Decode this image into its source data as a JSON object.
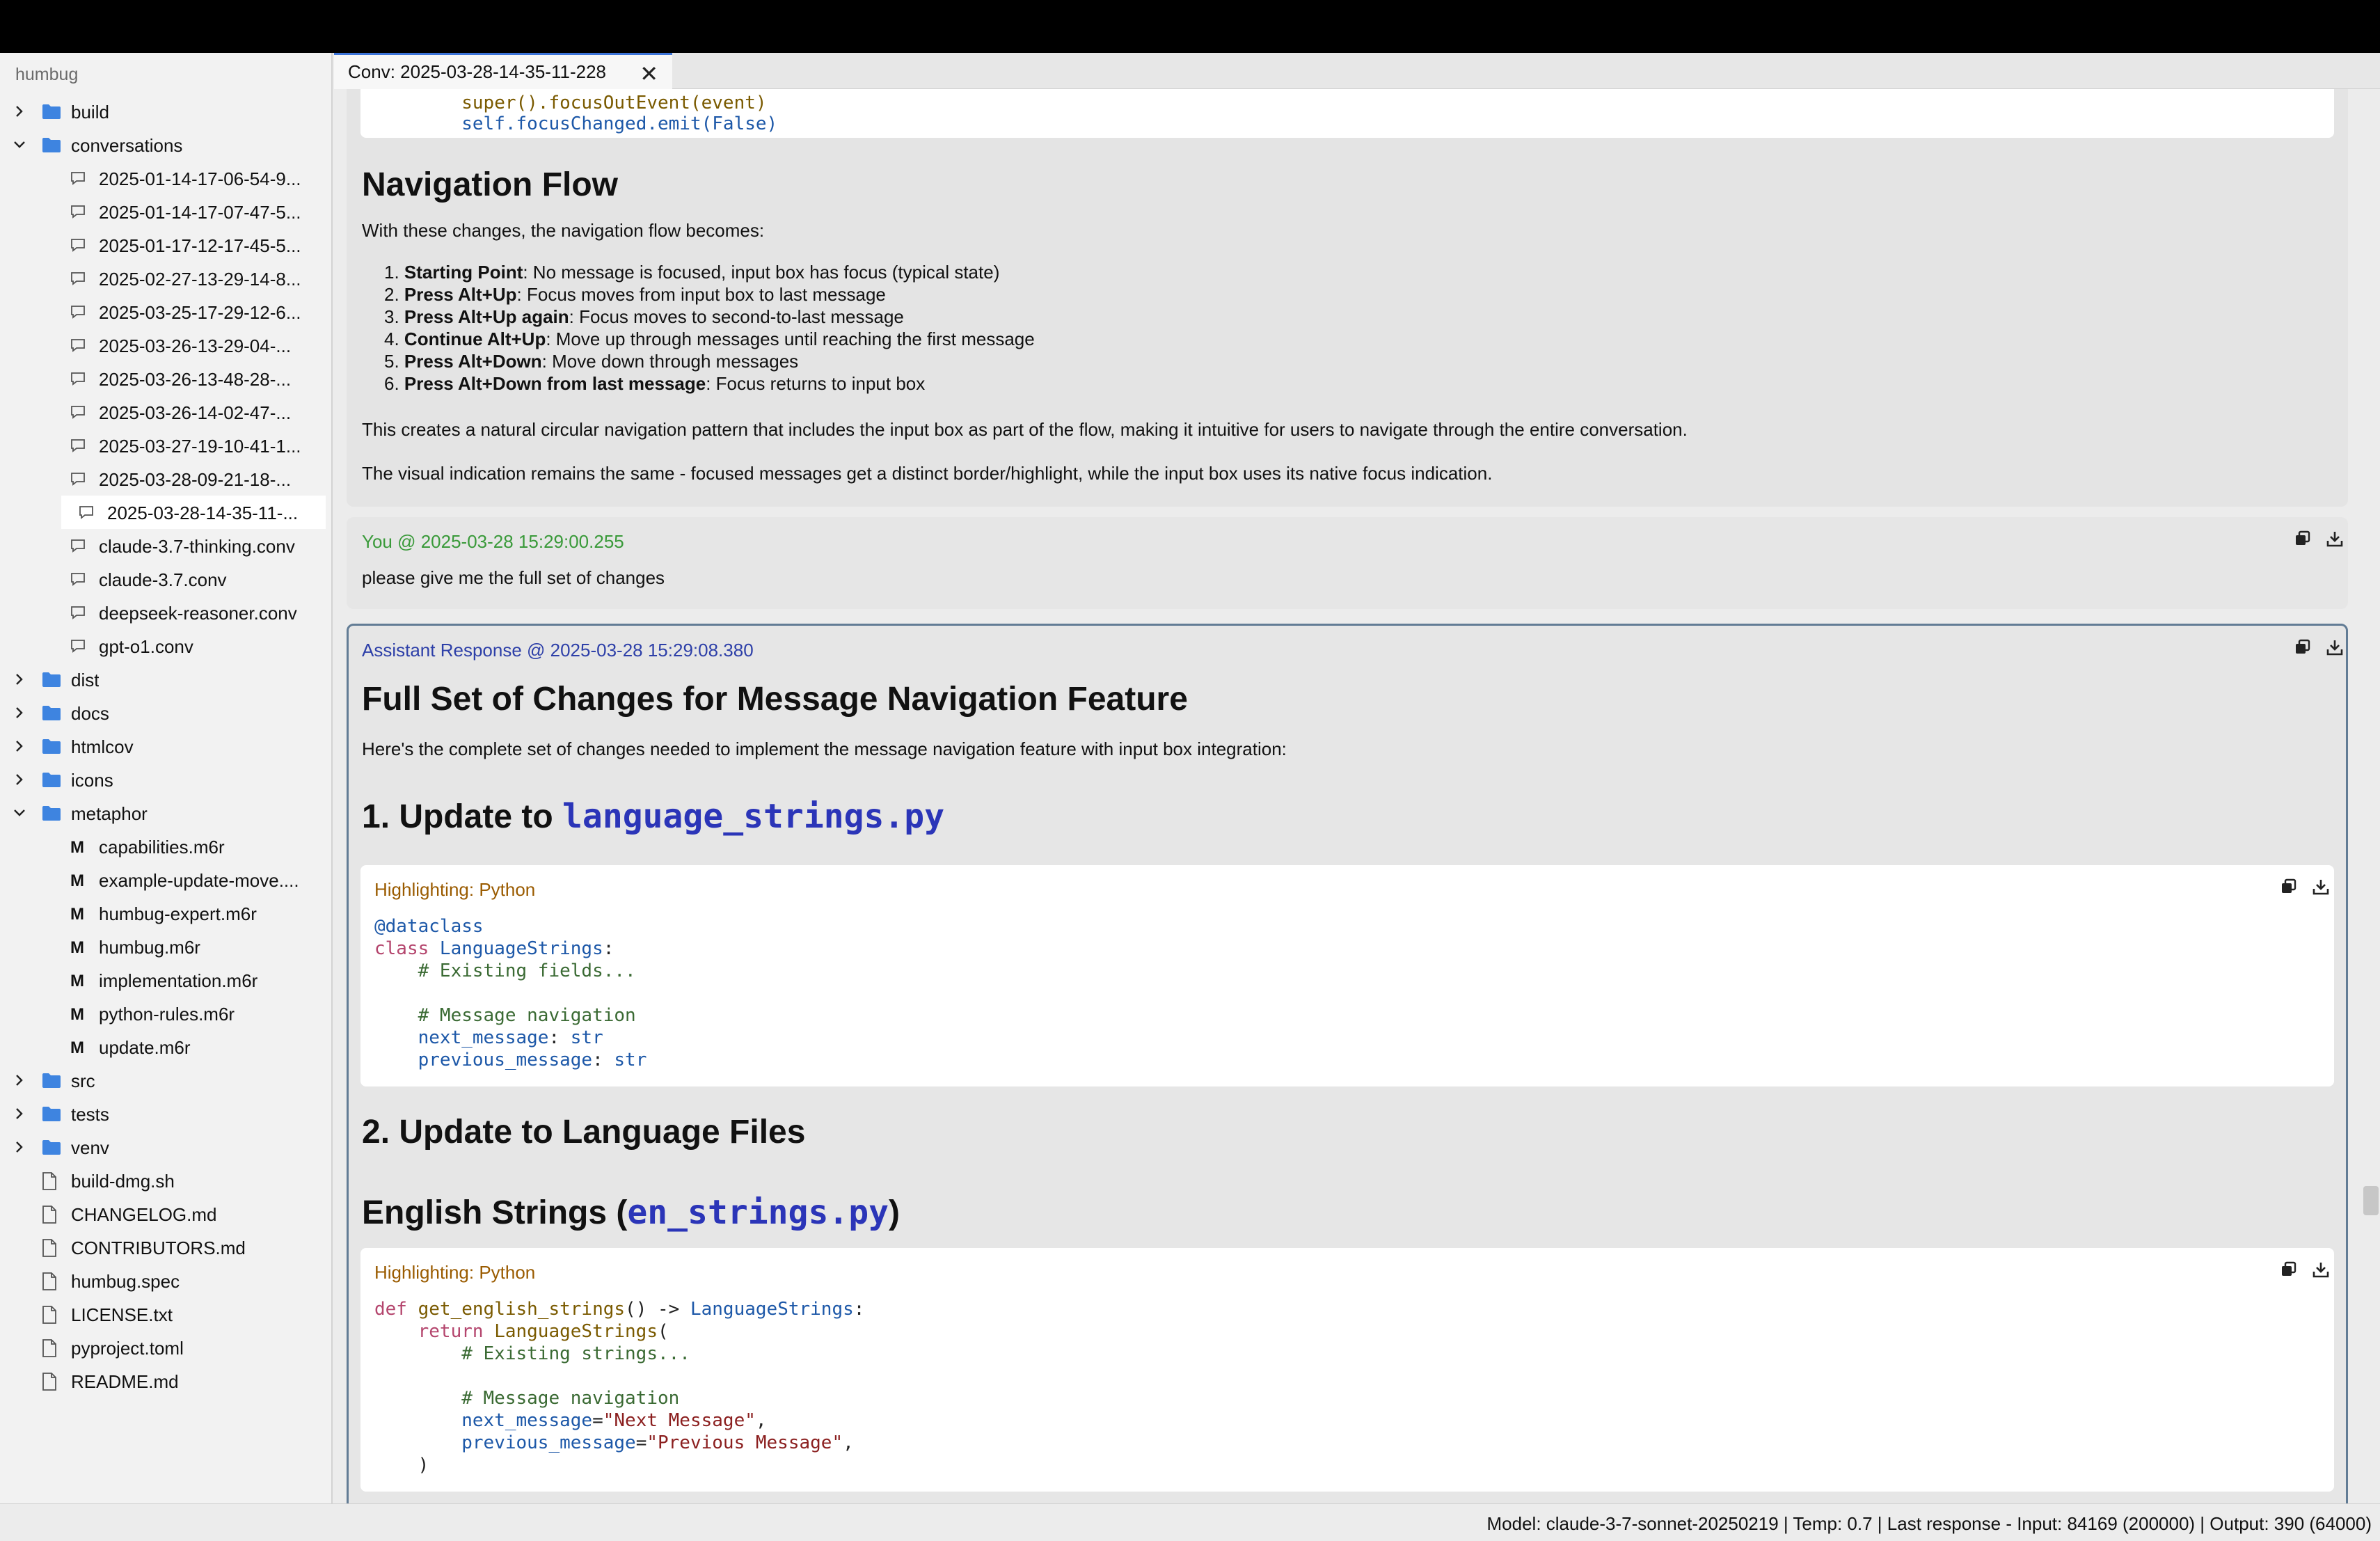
{
  "sidebar": {
    "root": "humbug",
    "items": [
      {
        "label": "build",
        "type": "folder",
        "expanded": false,
        "depth": 0
      },
      {
        "label": "conversations",
        "type": "folder",
        "expanded": true,
        "depth": 0
      },
      {
        "label": "2025-01-14-17-06-54-9...",
        "type": "conv",
        "depth": 1
      },
      {
        "label": "2025-01-14-17-07-47-5...",
        "type": "conv",
        "depth": 1
      },
      {
        "label": "2025-01-17-12-17-45-5...",
        "type": "conv",
        "depth": 1
      },
      {
        "label": "2025-02-27-13-29-14-8...",
        "type": "conv",
        "depth": 1
      },
      {
        "label": "2025-03-25-17-29-12-6...",
        "type": "conv",
        "depth": 1
      },
      {
        "label": "2025-03-26-13-29-04-...",
        "type": "conv",
        "depth": 1
      },
      {
        "label": "2025-03-26-13-48-28-...",
        "type": "conv",
        "depth": 1
      },
      {
        "label": "2025-03-26-14-02-47-...",
        "type": "conv",
        "depth": 1
      },
      {
        "label": "2025-03-27-19-10-41-1...",
        "type": "conv",
        "depth": 1
      },
      {
        "label": "2025-03-28-09-21-18-...",
        "type": "conv",
        "depth": 1
      },
      {
        "label": "2025-03-28-14-35-11-...",
        "type": "conv",
        "depth": 1,
        "selected": true
      },
      {
        "label": "claude-3.7-thinking.conv",
        "type": "conv",
        "depth": 1
      },
      {
        "label": "claude-3.7.conv",
        "type": "conv",
        "depth": 1
      },
      {
        "label": "deepseek-reasoner.conv",
        "type": "conv",
        "depth": 1
      },
      {
        "label": "gpt-o1.conv",
        "type": "conv",
        "depth": 1
      },
      {
        "label": "dist",
        "type": "folder",
        "expanded": false,
        "depth": 0
      },
      {
        "label": "docs",
        "type": "folder",
        "expanded": false,
        "depth": 0
      },
      {
        "label": "htmlcov",
        "type": "folder",
        "expanded": false,
        "depth": 0
      },
      {
        "label": "icons",
        "type": "folder",
        "expanded": false,
        "depth": 0
      },
      {
        "label": "metaphor",
        "type": "folder",
        "expanded": true,
        "depth": 0
      },
      {
        "label": "capabilities.m6r",
        "type": "m6r",
        "depth": 1
      },
      {
        "label": "example-update-move....",
        "type": "m6r",
        "depth": 1
      },
      {
        "label": "humbug-expert.m6r",
        "type": "m6r",
        "depth": 1
      },
      {
        "label": "humbug.m6r",
        "type": "m6r",
        "depth": 1
      },
      {
        "label": "implementation.m6r",
        "type": "m6r",
        "depth": 1
      },
      {
        "label": "python-rules.m6r",
        "type": "m6r",
        "depth": 1
      },
      {
        "label": "update.m6r",
        "type": "m6r",
        "depth": 1
      },
      {
        "label": "src",
        "type": "folder",
        "expanded": false,
        "depth": 0
      },
      {
        "label": "tests",
        "type": "folder",
        "expanded": false,
        "depth": 0
      },
      {
        "label": "venv",
        "type": "folder",
        "expanded": false,
        "depth": 0
      },
      {
        "label": "build-dmg.sh",
        "type": "file",
        "depth": 0
      },
      {
        "label": "CHANGELOG.md",
        "type": "file",
        "depth": 0
      },
      {
        "label": "CONTRIBUTORS.md",
        "type": "file",
        "depth": 0
      },
      {
        "label": "humbug.spec",
        "type": "file",
        "depth": 0
      },
      {
        "label": "LICENSE.txt",
        "type": "file",
        "depth": 0
      },
      {
        "label": "pyproject.toml",
        "type": "file",
        "depth": 0
      },
      {
        "label": "README.md",
        "type": "file",
        "depth": 0
      }
    ]
  },
  "tab": {
    "label": "Conv: 2025-03-28-14-35-11-228",
    "close": "✕"
  },
  "msg1": {
    "code_tail_1": "super().focusOutEvent(event)",
    "code_tail_2": "self.focusChanged.emit(False)",
    "heading": "Navigation Flow",
    "intro": "With these changes, the navigation flow becomes:",
    "steps": [
      {
        "n": "1.",
        "bold": "Starting Point",
        "text": ": No message is focused, input box has focus (typical state)"
      },
      {
        "n": "2.",
        "bold": "Press Alt+Up",
        "text": ": Focus moves from input box to last message"
      },
      {
        "n": "3.",
        "bold": "Press Alt+Up again",
        "text": ": Focus moves to second-to-last message"
      },
      {
        "n": "4.",
        "bold": "Continue Alt+Up",
        "text": ": Move up through messages until reaching the first message"
      },
      {
        "n": "5.",
        "bold": "Press Alt+Down",
        "text": ": Move down through messages"
      },
      {
        "n": "6.",
        "bold": "Press Alt+Down from last message",
        "text": ": Focus returns to input box"
      }
    ],
    "para1": "This creates a natural circular navigation pattern that includes the input box as part of the flow, making it intuitive for users to navigate through the entire conversation.",
    "para2": "The visual indication remains the same - focused messages get a distinct border/highlight, while the input box uses its native focus indication."
  },
  "msg2": {
    "header": "You @ 2025-03-28 15:29:00.255",
    "text": "please give me the full set of changes"
  },
  "msg3": {
    "header": "Assistant Response @ 2025-03-28 15:29:08.380",
    "title": "Full Set of Changes for Message Navigation Feature",
    "intro": "Here's the complete set of changes needed to implement the message navigation feature with input box integration:",
    "h_update1_prefix": "1. Update to ",
    "h_update1_code": "language_strings.py",
    "code1_label": "Highlighting: Python",
    "h_update2": "2. Update to Language Files",
    "h_english_prefix": "English Strings (",
    "h_english_code": "en_strings.py",
    "h_english_suffix": ")",
    "code2_label": "Highlighting: Python"
  },
  "code1_lines": [
    [
      [
        "dc",
        "@"
      ],
      [
        "id",
        "dataclass"
      ]
    ],
    [
      [
        "kw",
        "class "
      ],
      [
        "ty",
        "LanguageStrings"
      ],
      [
        "",
        ":"
      ]
    ],
    [
      [
        "cm",
        "    # Existing fields..."
      ]
    ],
    [
      [
        "",
        ""
      ]
    ],
    [
      [
        "cm",
        "    # Message navigation"
      ]
    ],
    [
      [
        "",
        "    "
      ],
      [
        "id",
        "next_message"
      ],
      [
        "",
        ": "
      ],
      [
        "ty",
        "str"
      ]
    ],
    [
      [
        "",
        "    "
      ],
      [
        "id",
        "previous_message"
      ],
      [
        "",
        ": "
      ],
      [
        "ty",
        "str"
      ]
    ]
  ],
  "code2_lines": [
    [
      [
        "kw",
        "def "
      ],
      [
        "fn",
        "get_english_strings"
      ],
      [
        "",
        "() -> "
      ],
      [
        "ty",
        "LanguageStrings"
      ],
      [
        "",
        ":"
      ]
    ],
    [
      [
        "kw",
        "    return "
      ],
      [
        "fn",
        "LanguageStrings"
      ],
      [
        "",
        "("
      ]
    ],
    [
      [
        "cm",
        "        # Existing strings..."
      ]
    ],
    [
      [
        "",
        ""
      ]
    ],
    [
      [
        "cm",
        "        # Message navigation"
      ]
    ],
    [
      [
        "",
        "        "
      ],
      [
        "id",
        "next_message"
      ],
      [
        "",
        "="
      ],
      [
        "st",
        "\"Next Message\""
      ],
      [
        "",
        ","
      ]
    ],
    [
      [
        "",
        "        "
      ],
      [
        "id",
        "previous_message"
      ],
      [
        "",
        "="
      ],
      [
        "st",
        "\"Previous Message\""
      ],
      [
        "",
        ","
      ]
    ],
    [
      [
        "",
        "    )"
      ]
    ]
  ],
  "status": "Model: claude-3-7-sonnet-20250219 | Temp: 0.7 | Last response - Input: 84169 (200000) | Output: 390 (64000)",
  "colors": {
    "user_header": "#3a9a3a",
    "assistant_header": "#2d3fa8",
    "code_heading": "#2b35b8",
    "accent": "#3c74d8"
  }
}
